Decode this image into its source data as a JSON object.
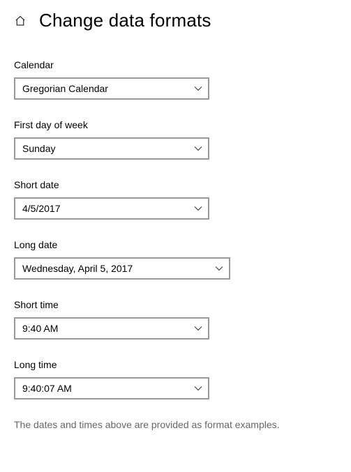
{
  "header": {
    "title": "Change data formats"
  },
  "fields": {
    "calendar": {
      "label": "Calendar",
      "value": "Gregorian Calendar"
    },
    "first_day": {
      "label": "First day of week",
      "value": "Sunday"
    },
    "short_date": {
      "label": "Short date",
      "value": "4/5/2017"
    },
    "long_date": {
      "label": "Long date",
      "value": "Wednesday, April 5, 2017"
    },
    "short_time": {
      "label": "Short time",
      "value": "9:40 AM"
    },
    "long_time": {
      "label": "Long time",
      "value": "9:40:07 AM"
    }
  },
  "note": "The dates and times above are provided as format examples."
}
